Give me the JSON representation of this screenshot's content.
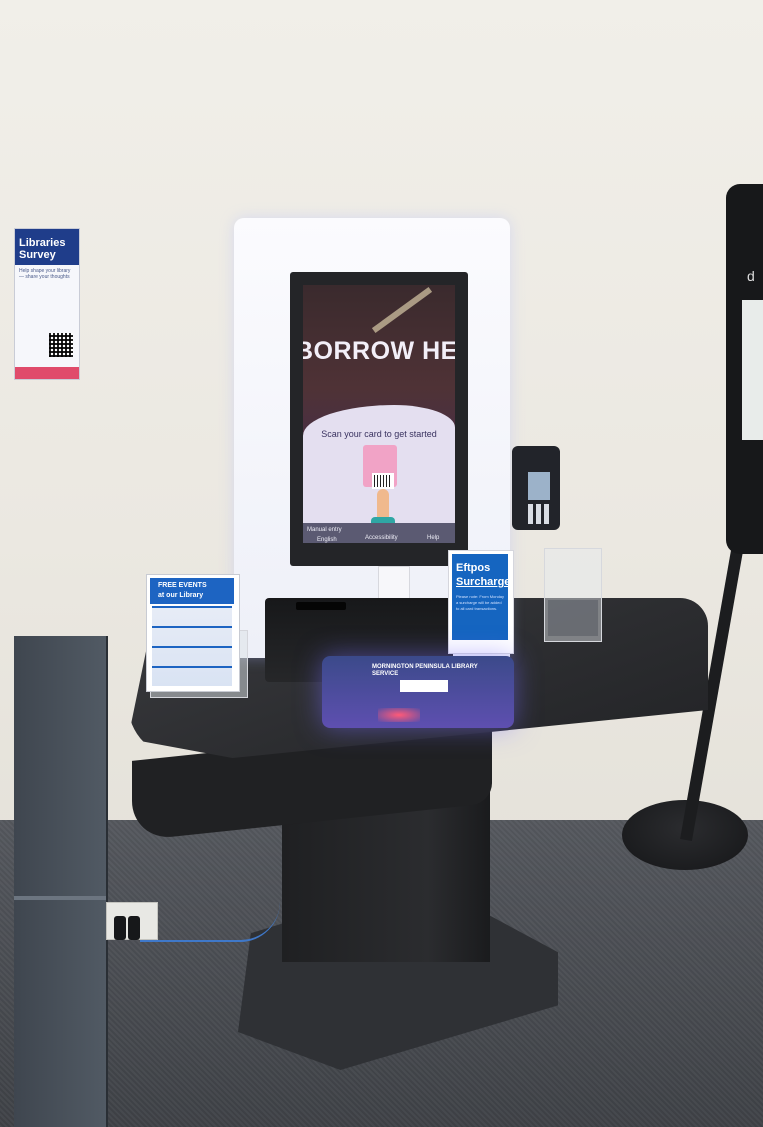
{
  "poster": {
    "heading": "Libraries Survey",
    "question": "Help shape your library — share your thoughts"
  },
  "kiosk": {
    "screen_headline": "BORROW HERE",
    "screen_subtitle": "Scan your card to get started",
    "manual_entry_label": "Manual entry",
    "language_label": "English",
    "accessibility_label": "Accessibility",
    "help_label": "Help"
  },
  "eftpos_sign": {
    "line1": "Eftpos",
    "line2": "Surcharge",
    "note": "Please note: From Monday a surcharge will be added to all card transactions."
  },
  "brochure": {
    "line1": "FREE EVENTS",
    "line2": "at our Library"
  },
  "scan_mat": {
    "title": "MORNINGTON PENINSULA LIBRARY SERVICE"
  },
  "pole": {
    "letter": "d"
  }
}
